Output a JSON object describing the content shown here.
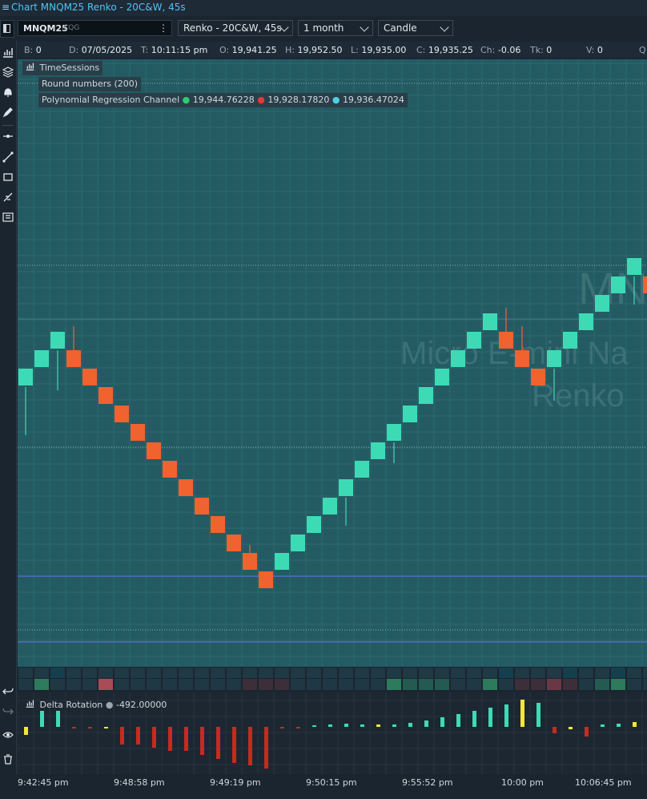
{
  "window": {
    "title": "Chart MNQM25 Renko - 20C&W, 45s"
  },
  "toolbar": {
    "symbol": "MNQM25",
    "feed": "CQG",
    "chart_type": "Renko - 20C&W, 45s",
    "period": "1 month",
    "style": "Candle"
  },
  "info": {
    "b_label": "B:",
    "b": "0",
    "d_label": "D:",
    "d": "07/05/2025",
    "t_label": "T:",
    "t": "10:11:15 pm",
    "o_label": "O:",
    "o": "19,941.25",
    "h_label": "H:",
    "h": "19,952.50",
    "l_label": "L:",
    "l": "19,935.00",
    "c_label": "C:",
    "c": "19,935.25",
    "ch_label": "Ch:",
    "ch": "-0.06",
    "tk_label": "Tk:",
    "tk": "0",
    "v_label": "V:",
    "v": "0",
    "q_label": "Q"
  },
  "legend": {
    "sessions": "TimeSessions",
    "round": "Round numbers (200)",
    "poly": "Polynomial Regression Channel",
    "poly_v1": "19,944.76228",
    "poly_v2": "19,928.17820",
    "poly_v3": "19,936.47024"
  },
  "watermark": {
    "symbol": "MNQ",
    "name": "Micro E-mini Na",
    "type": "Renko"
  },
  "indicator": {
    "name": "Delta Rotation",
    "value": "-492.00000"
  },
  "time_labels": [
    "9:42:45 pm",
    "9:48:58 pm",
    "9:49:19 pm",
    "9:50:15 pm",
    "9:55:52 pm",
    "10:00 pm",
    "10:06:45 pm"
  ],
  "colors": {
    "up": "#3ddbb5",
    "down": "#f0622f",
    "bg": "#245b63",
    "neg": "#c62b1f",
    "pos": "#3ddbb5",
    "flat": "#f5e63a"
  },
  "chart_data": {
    "type": "candlestick",
    "renko_bricks": [
      {
        "dir": "up",
        "level": 0
      },
      {
        "dir": "up",
        "level": 1
      },
      {
        "dir": "up",
        "level": 2
      },
      {
        "dir": "down",
        "level": 1
      },
      {
        "dir": "down",
        "level": 0
      },
      {
        "dir": "down",
        "level": -1
      },
      {
        "dir": "down",
        "level": -2
      },
      {
        "dir": "down",
        "level": -3
      },
      {
        "dir": "down",
        "level": -4
      },
      {
        "dir": "down",
        "level": -5
      },
      {
        "dir": "down",
        "level": -6
      },
      {
        "dir": "down",
        "level": -7
      },
      {
        "dir": "down",
        "level": -8
      },
      {
        "dir": "down",
        "level": -9
      },
      {
        "dir": "down",
        "level": -10
      },
      {
        "dir": "down",
        "level": -11
      },
      {
        "dir": "up",
        "level": -10
      },
      {
        "dir": "up",
        "level": -9
      },
      {
        "dir": "up",
        "level": -8
      },
      {
        "dir": "up",
        "level": -7
      },
      {
        "dir": "up",
        "level": -6
      },
      {
        "dir": "up",
        "level": -5
      },
      {
        "dir": "up",
        "level": -4
      },
      {
        "dir": "up",
        "level": -3
      },
      {
        "dir": "up",
        "level": -2
      },
      {
        "dir": "up",
        "level": -1
      },
      {
        "dir": "up",
        "level": 0
      },
      {
        "dir": "up",
        "level": 1
      },
      {
        "dir": "up",
        "level": 2
      },
      {
        "dir": "up",
        "level": 3
      },
      {
        "dir": "down",
        "level": 2
      },
      {
        "dir": "down",
        "level": 1
      },
      {
        "dir": "down",
        "level": 0
      },
      {
        "dir": "up",
        "level": 1
      },
      {
        "dir": "up",
        "level": 2
      },
      {
        "dir": "up",
        "level": 3
      },
      {
        "dir": "up",
        "level": 4
      },
      {
        "dir": "up",
        "level": 5
      },
      {
        "dir": "up",
        "level": 6
      },
      {
        "dir": "down",
        "level": 5
      }
    ],
    "delta_rotation": [
      -10,
      20,
      20,
      -1,
      -1,
      -2,
      -22,
      -22,
      -26,
      -30,
      -30,
      -35,
      -40,
      -45,
      -48,
      -52,
      -1,
      -1,
      2,
      3,
      4,
      3,
      3,
      3,
      5,
      8,
      12,
      16,
      20,
      24,
      28,
      34,
      30,
      -8,
      -3,
      -12,
      3,
      4,
      6,
      10,
      20,
      -6
    ],
    "delta_flat_idx": [
      0,
      5,
      22,
      31,
      34,
      38
    ],
    "legend": [
      "Delta Rotation"
    ]
  }
}
